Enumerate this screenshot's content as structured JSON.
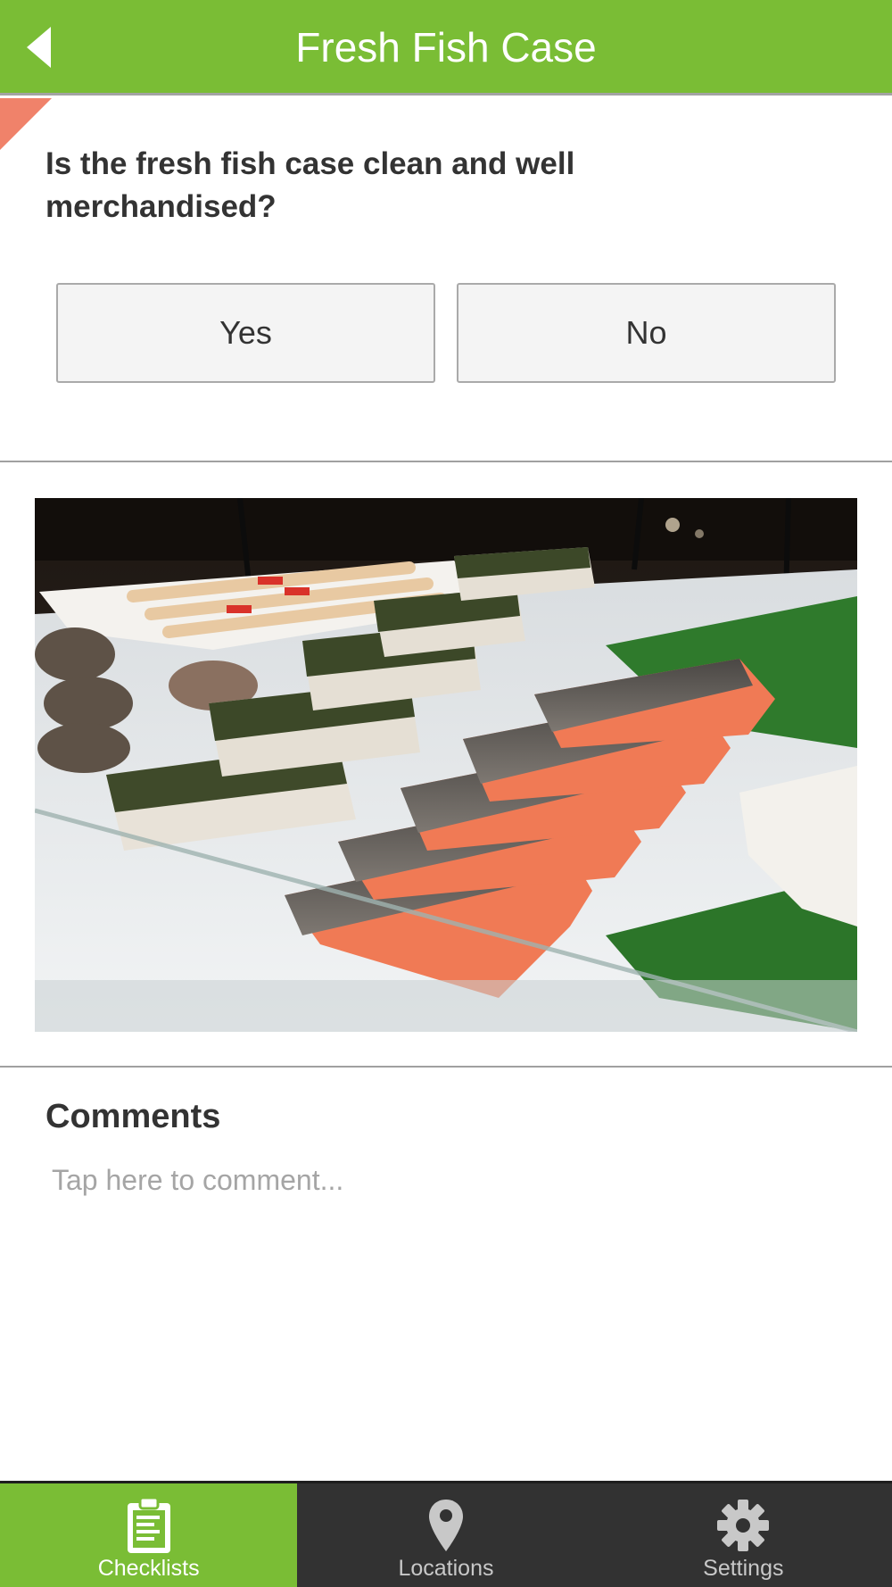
{
  "header": {
    "title": "Fresh Fish Case",
    "back_icon": "back-arrow-icon",
    "background": "#7abd35"
  },
  "question": {
    "text": "Is the fresh fish case clean and well merchandised?",
    "flag_color": "#f0826a"
  },
  "answers": {
    "yes_label": "Yes",
    "no_label": "No"
  },
  "photo": {
    "subject": "fish-display-photo"
  },
  "comments": {
    "title": "Comments",
    "placeholder": "Tap here to comment...",
    "value": ""
  },
  "tabbar": {
    "background": "#323232",
    "active_color": "#7abd35",
    "tabs": [
      {
        "label": "Checklists",
        "icon": "clipboard-icon",
        "active": true
      },
      {
        "label": "Locations",
        "icon": "map-pin-icon",
        "active": false
      },
      {
        "label": "Settings",
        "icon": "gear-icon",
        "active": false
      }
    ]
  }
}
